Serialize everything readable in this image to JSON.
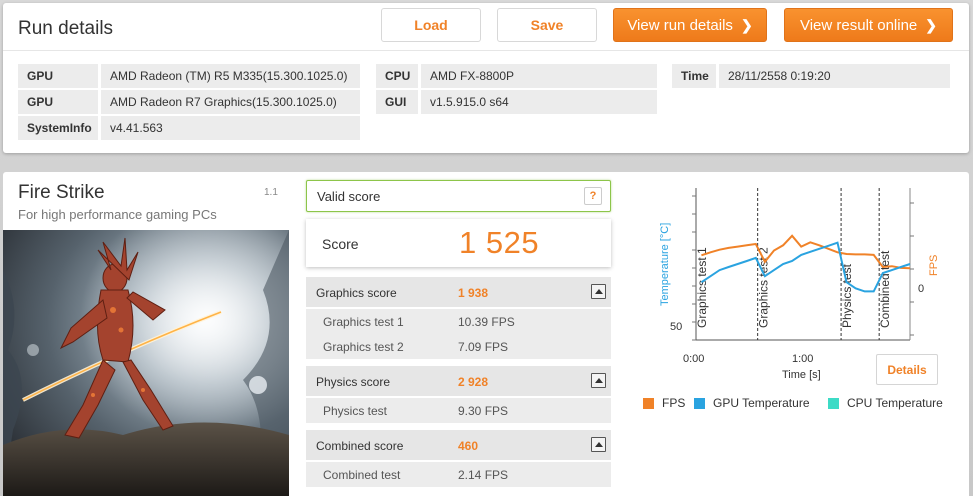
{
  "header": {
    "title": "Run details",
    "load_label": "Load",
    "save_label": "Save",
    "view_run_label": "View run details",
    "view_online_label": "View result online"
  },
  "info": {
    "gpu1_label": "GPU",
    "gpu1_value": "AMD Radeon (TM) R5 M335(15.300.1025.0)",
    "gpu2_label": "GPU",
    "gpu2_value": "AMD Radeon R7 Graphics(15.300.1025.0)",
    "sysinfo_label": "SystemInfo",
    "sysinfo_value": "v4.41.563",
    "cpu_label": "CPU",
    "cpu_value": "AMD FX-8800P",
    "gui_label": "GUI",
    "gui_value": "v1.5.915.0 s64",
    "time_label": "Time",
    "time_value": "28/11/2558 0:19:20"
  },
  "test": {
    "name": "Fire Strike",
    "subtitle": "For high performance gaming PCs",
    "version": "1.1"
  },
  "score": {
    "valid_label": "Valid score",
    "help_label": "?",
    "label": "Score",
    "value": "1 525"
  },
  "sections": {
    "graphics": {
      "label": "Graphics score",
      "value": "1 938",
      "test1_label": "Graphics test 1",
      "test1_value": "10.39 FPS",
      "test2_label": "Graphics test 2",
      "test2_value": "7.09 FPS"
    },
    "physics": {
      "label": "Physics score",
      "value": "2 928",
      "test_label": "Physics test",
      "test_value": "9.30 FPS"
    },
    "combined": {
      "label": "Combined score",
      "value": "460",
      "test_label": "Combined test",
      "test_value": "2.14 FPS"
    }
  },
  "chart_labels": {
    "details_label": "Details"
  },
  "chart_data": {
    "type": "line",
    "xlabel": "Time [s]",
    "ylabel_left": "Temperature [°C]",
    "ylabel_right": "FPS",
    "x_ticks": [
      "0:00",
      "1:00"
    ],
    "y_left_ticks": [
      "50"
    ],
    "y_right_ticks": [
      "0"
    ],
    "phase_labels": [
      "Graphics test 1",
      "Graphics test 2",
      "Physics test",
      "Combined test"
    ],
    "phase_boundaries_s": [
      0,
      34,
      80,
      101
    ],
    "x_range_s": [
      0,
      118
    ],
    "colors": {
      "fps": "#f08228",
      "gpu": "#2aa3e0",
      "cpu": "#3ddbc6"
    },
    "series": [
      {
        "name": "FPS",
        "x": [
          3,
          8,
          13,
          18,
          23,
          28,
          33,
          38,
          43,
          48,
          53,
          58,
          63,
          68,
          73,
          78,
          83,
          88,
          93,
          98,
          103,
          108,
          113,
          118
        ],
        "values": [
          9.5,
          10.2,
          10.8,
          11.2,
          11.5,
          11.8,
          12.1,
          8.0,
          10.6,
          11.8,
          14.0,
          11.5,
          12.5,
          11.8,
          11.0,
          10.2,
          9.8,
          9.7,
          9.7,
          9.6,
          6.8,
          7.0,
          6.6,
          6.5
        ]
      },
      {
        "name": "GPU Temperature",
        "x": [
          3,
          8,
          13,
          18,
          23,
          28,
          33,
          38,
          43,
          48,
          53,
          58,
          63,
          68,
          73,
          78,
          83,
          88,
          93,
          98,
          103,
          108,
          113,
          118
        ],
        "values": [
          64,
          66,
          68,
          69,
          70,
          71,
          72,
          66,
          68,
          70,
          71,
          73,
          74,
          75,
          76,
          77,
          64,
          62,
          61,
          61,
          67,
          68,
          69,
          70
        ]
      },
      {
        "name": "CPU Temperature",
        "x": [],
        "values": []
      }
    ]
  }
}
